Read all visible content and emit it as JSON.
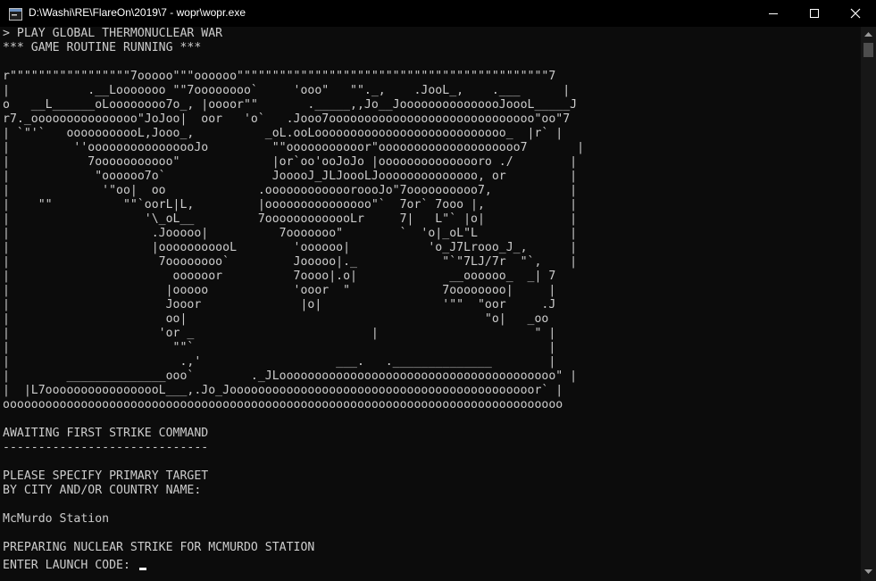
{
  "window": {
    "title": "D:\\Washi\\RE\\FlareOn\\2019\\7 - wopr\\wopr.exe",
    "icons": [
      "console-app-icon",
      "minimize-icon",
      "maximize-icon",
      "close-icon"
    ]
  },
  "console": {
    "lines": [
      "> PLAY GLOBAL THERMONUCLEAR WAR",
      "*** GAME ROUTINE RUNNING ***",
      "",
      "r\"\"\"\"\"\"\"\"\"\"\"\"\"\"\"\"\"7ooooo\"\"\"oooooo\"\"\"\"\"\"\"\"\"\"\"\"\"\"\"\"\"\"\"\"\"\"\"\"\"\"\"\"\"\"\"\"\"\"\"\"\"\"\"\"\"\"\"\"7",
      "|           .__Looooooo \"\"7oooooooo`     'ooo\"   \"\"._,    .JooL_,    .___      |",
      "o   __L______oLoooooooo7o_, |oooor\"\"       ._____,,Jo__JooooooooooooooJoooL_____J",
      "r7._ooooooooooooooo\"JoJoo|  oor   'o`   .Jooo7ooooooooooooooooooooooooooooo\"oo\"7",
      "| `\"'`   ooooooooooL,Jooo_,          _oL.ooLooooooooooooooooooooooooooo_  |r` |",
      "|         ''oooooooooooooooJo         \"\"ooooooooooor\"oooooooooooooooooooo7       |",
      "|           7ooooooooooo\"             |or`oo'ooJoJo |ooooooooooooooro ./        |",
      "|            \"oooooo7o`               JooooJ_JLJoooLJoooooooooooooo, or         |",
      "|             '\"oo|  oo             .ooooooooooooroooJo\"7oooooooooo7,           |",
      "|    \"\"          \"\"`oorL|L,         |ooooooooooooooo\"`  7or` 7ooo |,            |",
      "|                   '\\_oL__         7ooooooooooooLr     7|   L\"` |o|            |",
      "|                    .Jooooo|          7ooooooo\"        `  'o|_oL\"L             |",
      "|                    |ooooooooooL        'oooooo|           'o_J7Lrooo_J_,      |",
      "|                     7oooooooo`         Jooooo|._            \"`\"7LJ/7r  \"`,    |",
      "|                       oooooor          7oooo|.o|             __oooooo_  _| 7",
      "|                      |ooooo            'ooor  \"             7oooooooo|     |",
      "|                      Jooor              |o|                 '\"\"  \"oor     .J",
      "|                      oo|                                          \"o|   _oo",
      "|                     'or _                         |                      \" |",
      "|                       \"\"`                                                  |",
      "|                        .,'                   ___.   .______________        |",
      "|        ______________ooo`        ._JLooooooooooooooooooooooooooooooooooooooo\" |",
      "|  |L7ooooooooooooooooL___,.Jo_Jooooooooooooooooooooooooooooooooooooooooooor` |",
      "ooooooooooooooooooooooooooooooooooooooooooooooooooooooooooooooooooooooooooooooo",
      "",
      "AWAITING FIRST STRIKE COMMAND",
      "-----------------------------",
      "",
      "PLEASE SPECIFY PRIMARY TARGET",
      "BY CITY AND/OR COUNTRY NAME:",
      "",
      "McMurdo Station",
      "",
      "PREPARING NUCLEAR STRIKE FOR MCMURDO STATION"
    ],
    "prompt": "ENTER LAUNCH CODE: "
  }
}
